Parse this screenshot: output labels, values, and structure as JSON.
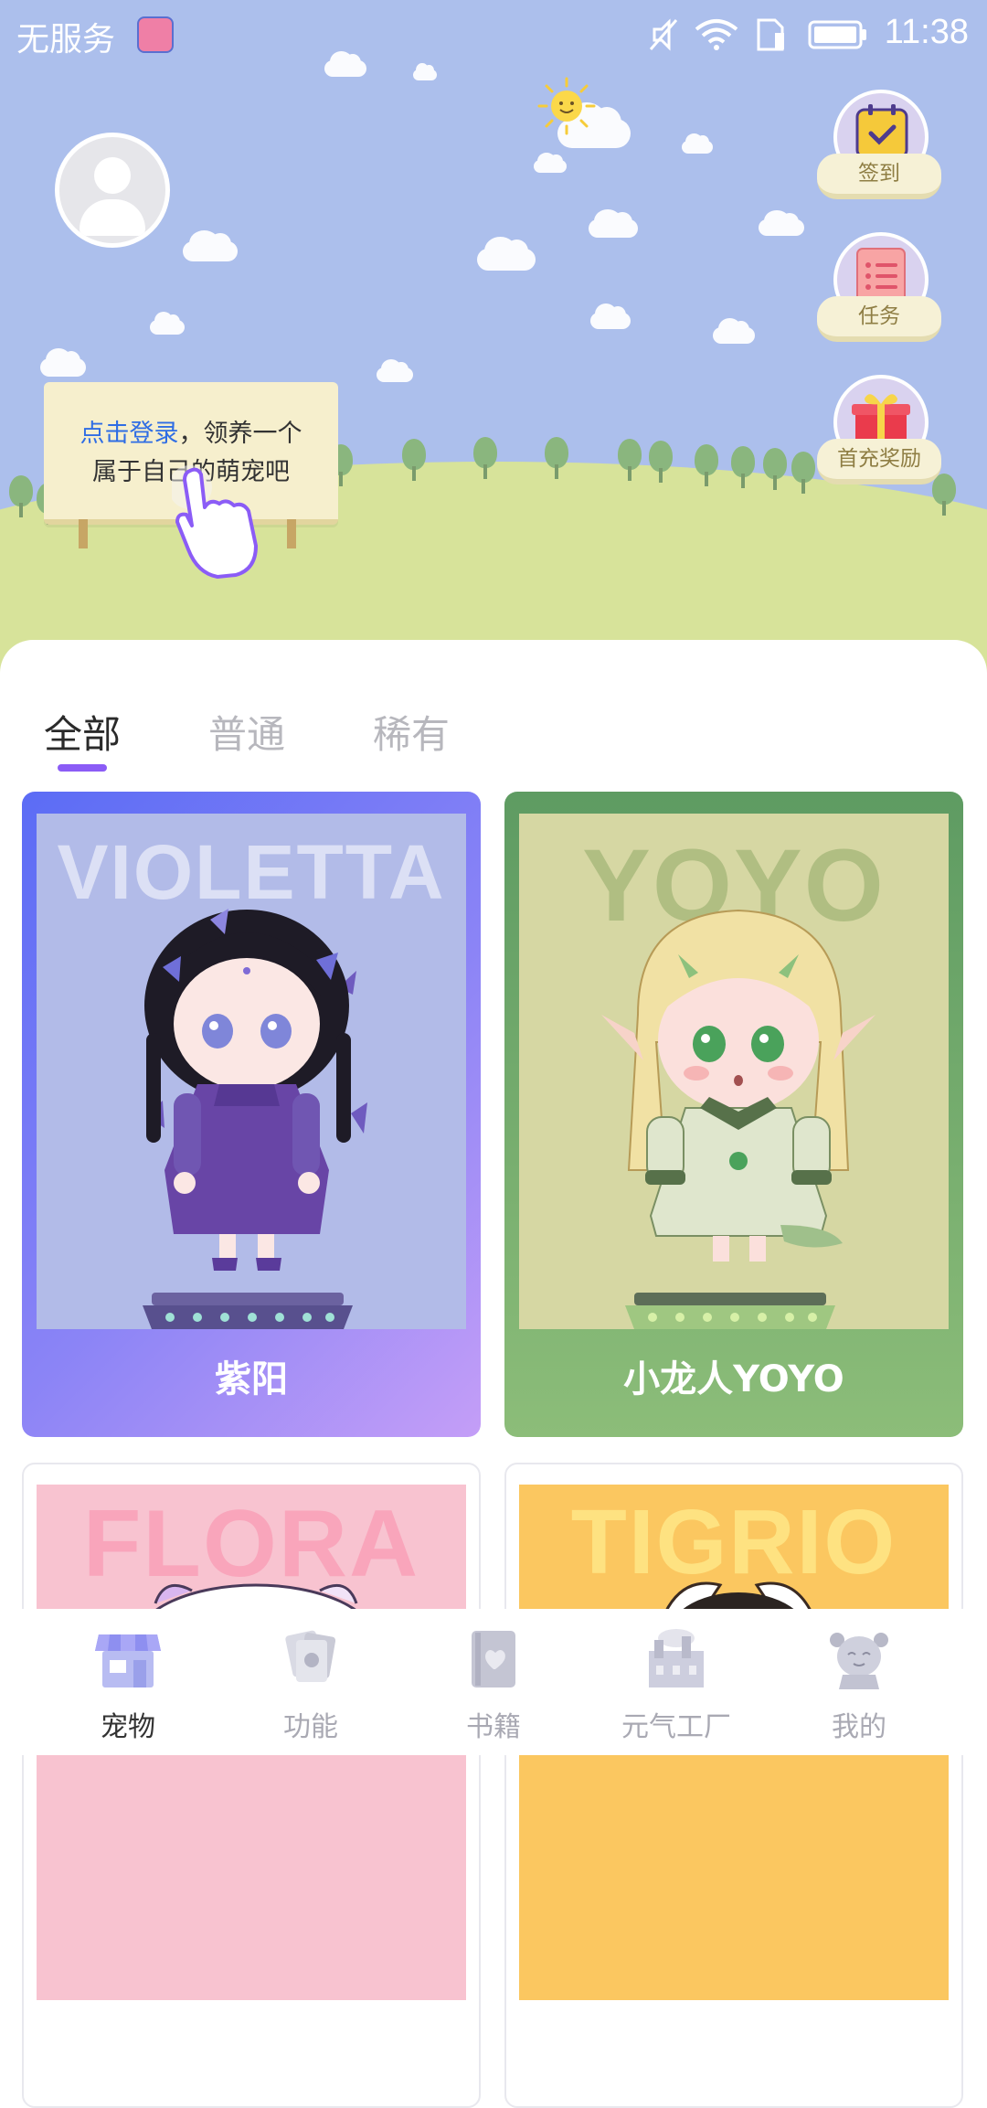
{
  "status_bar": {
    "carrier": "无服务",
    "time": "11:38",
    "icons": [
      "app-icon",
      "mute-icon",
      "wifi-icon",
      "sim-icon",
      "battery-icon"
    ]
  },
  "actions": {
    "sign_in": "签到",
    "tasks": "任务",
    "first_recharge": "首充奖励"
  },
  "login_board": {
    "link_text": "点击登录",
    "line1_rest": "，领养一个",
    "line2": "属于自己的萌宠吧"
  },
  "tabs": [
    {
      "label": "全部",
      "active": true
    },
    {
      "label": "普通",
      "active": false
    },
    {
      "label": "稀有",
      "active": false
    }
  ],
  "pets": [
    {
      "bg_word": "VIOLETTA",
      "name": "紫阳",
      "theme": "#7b7ff3"
    },
    {
      "bg_word": "YOYO",
      "name": "小龙人YOYO",
      "theme": "#7fae6f"
    },
    {
      "bg_word": "FLORA",
      "name": "",
      "theme": "#f8c3d0"
    },
    {
      "bg_word": "TIGRIO",
      "name": "",
      "theme": "#fbc760"
    }
  ],
  "bottom_nav": [
    {
      "label": "宠物",
      "icon": "shop-icon",
      "active": true
    },
    {
      "label": "功能",
      "icon": "cards-icon",
      "active": false
    },
    {
      "label": "书籍",
      "icon": "book-icon",
      "active": false
    },
    {
      "label": "元气工厂",
      "icon": "factory-icon",
      "active": false
    },
    {
      "label": "我的",
      "icon": "profile-icon",
      "active": false
    }
  ]
}
